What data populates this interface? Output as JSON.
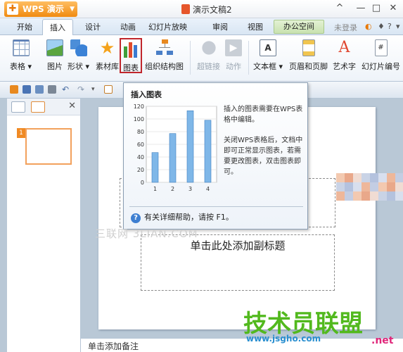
{
  "titlebar": {
    "app_name": "WPS 演示",
    "doc_title": "演示文稿2",
    "controls": [
      "^",
      "—",
      "□",
      "✕"
    ]
  },
  "tabs": {
    "items": [
      "开始",
      "插入",
      "设计",
      "动画",
      "幻灯片放映",
      "审阅",
      "视图"
    ],
    "office_space": "办公空间",
    "login": "未登录"
  },
  "ribbon": {
    "table": "表格",
    "picture": "图片",
    "shapes": "形状",
    "material": "素材库",
    "chart": "图表",
    "org_chart": "组织结构图",
    "hyperlink": "超链接",
    "action": "动作",
    "textbox": "文本框",
    "header_footer": "页眉和页脚",
    "wordart": "艺术字",
    "slide_number": "幻灯片编号"
  },
  "slides_pane": {
    "slide_number": "1"
  },
  "slide": {
    "subtitle_placeholder": "单击此处添加副标题"
  },
  "notes": {
    "placeholder": "单击添加备注"
  },
  "tooltip": {
    "title": "插入图表",
    "desc1": "插入的图表需要在WPS表格中编辑。",
    "desc2": "关闭WPS表格后，文档中即可正常显示图表，若需要更改图表，双击图表即可。",
    "help": "有关详细帮助，请按 F1。",
    "chart_data": {
      "type": "bar",
      "categories": [
        "1",
        "2",
        "3",
        "4"
      ],
      "values": [
        47,
        77,
        113,
        98
      ],
      "yticks": [
        "120",
        "100",
        "80",
        "60",
        "40",
        "20",
        "0"
      ],
      "ylim": [
        0,
        120
      ]
    }
  },
  "watermarks": {
    "site_cn": "三联网 3LIAN.COM",
    "brand": "技术员联盟",
    "url": "www.jsgho.com",
    "net": ".net"
  },
  "colors": {
    "accent_orange": "#f08a10",
    "selection_red": "#c0262c",
    "brand_green": "#52b91e"
  }
}
